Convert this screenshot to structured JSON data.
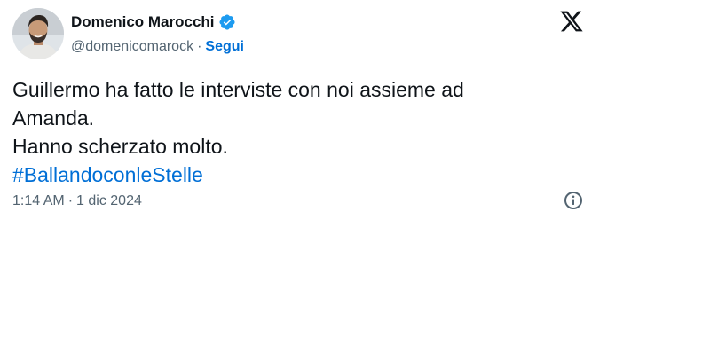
{
  "author": {
    "display_name": "Domenico Marocchi",
    "handle": "@domenicomarock",
    "separator": "·",
    "follow_label": "Segui",
    "verified": true,
    "verified_color": "#1d9bf0"
  },
  "tweet": {
    "lines": [
      "Guillermo ha fatto le interviste con noi assieme ad",
      "Amanda.",
      "Hanno scherzato molto."
    ],
    "hashtag": "#BallandoconleStelle"
  },
  "meta": {
    "time": "1:14 AM",
    "separator": "·",
    "date": "1 dic 2024"
  },
  "icons": {
    "brand": "x-logo-icon",
    "info": "info-icon",
    "verified": "verified-badge-icon"
  },
  "colors": {
    "text": "#0f1419",
    "secondary": "#536471",
    "link": "#006fd6"
  }
}
